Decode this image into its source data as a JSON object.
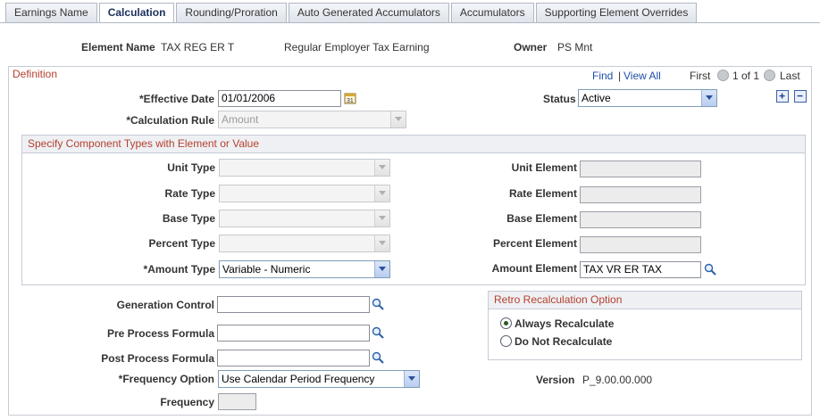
{
  "tabs": [
    {
      "label": "Earnings Name"
    },
    {
      "label": "Calculation"
    },
    {
      "label": "Rounding/Proration"
    },
    {
      "label": "Auto Generated Accumulators"
    },
    {
      "label": "Accumulators"
    },
    {
      "label": "Supporting Element Overrides"
    }
  ],
  "header": {
    "element_name_label": "Element Name",
    "element_name_value": "TAX REG ER T",
    "description": "Regular Employer Tax Earning",
    "owner_label": "Owner",
    "owner_value": "PS Mnt"
  },
  "definition": {
    "title": "Definition",
    "find": "Find",
    "separator": "|",
    "view_all": "View All",
    "first": "First",
    "page_count": "1 of 1",
    "last": "Last",
    "effective_date_label": "*Effective Date",
    "effective_date_value": "01/01/2006",
    "status_label": "Status",
    "status_value": "Active",
    "calc_rule_label": "*Calculation Rule",
    "calc_rule_value": "Amount"
  },
  "components": {
    "title": "Specify Component Types with Element or Value",
    "unit_type_label": "Unit Type",
    "rate_type_label": "Rate Type",
    "base_type_label": "Base Type",
    "percent_type_label": "Percent Type",
    "amount_type_label": "*Amount Type",
    "amount_type_value": "Variable - Numeric",
    "unit_element_label": "Unit Element",
    "rate_element_label": "Rate Element",
    "base_element_label": "Base Element",
    "percent_element_label": "Percent Element",
    "amount_element_label": "Amount Element",
    "amount_element_value": "TAX VR ER TAX"
  },
  "bottom": {
    "generation_control_label": "Generation Control",
    "pre_process_label": "Pre Process Formula",
    "post_process_label": "Post Process Formula",
    "frequency_option_label": "*Frequency Option",
    "frequency_option_value": "Use Calendar Period Frequency",
    "frequency_label": "Frequency",
    "version_label": "Version",
    "version_value": "P_9.00.00.000"
  },
  "retro": {
    "title": "Retro Recalculation Option",
    "always_label": "Always Recalculate",
    "never_label": "Do Not Recalculate",
    "selected": "Always Recalculate"
  },
  "colors": {
    "group_title": "#b5402c",
    "link": "#1f4ea8",
    "border": "#c6ccd5"
  },
  "icons": {
    "lookup": "magnifier-icon",
    "calendar": "calendar-icon",
    "add": "plus-icon",
    "remove": "minus-icon"
  }
}
